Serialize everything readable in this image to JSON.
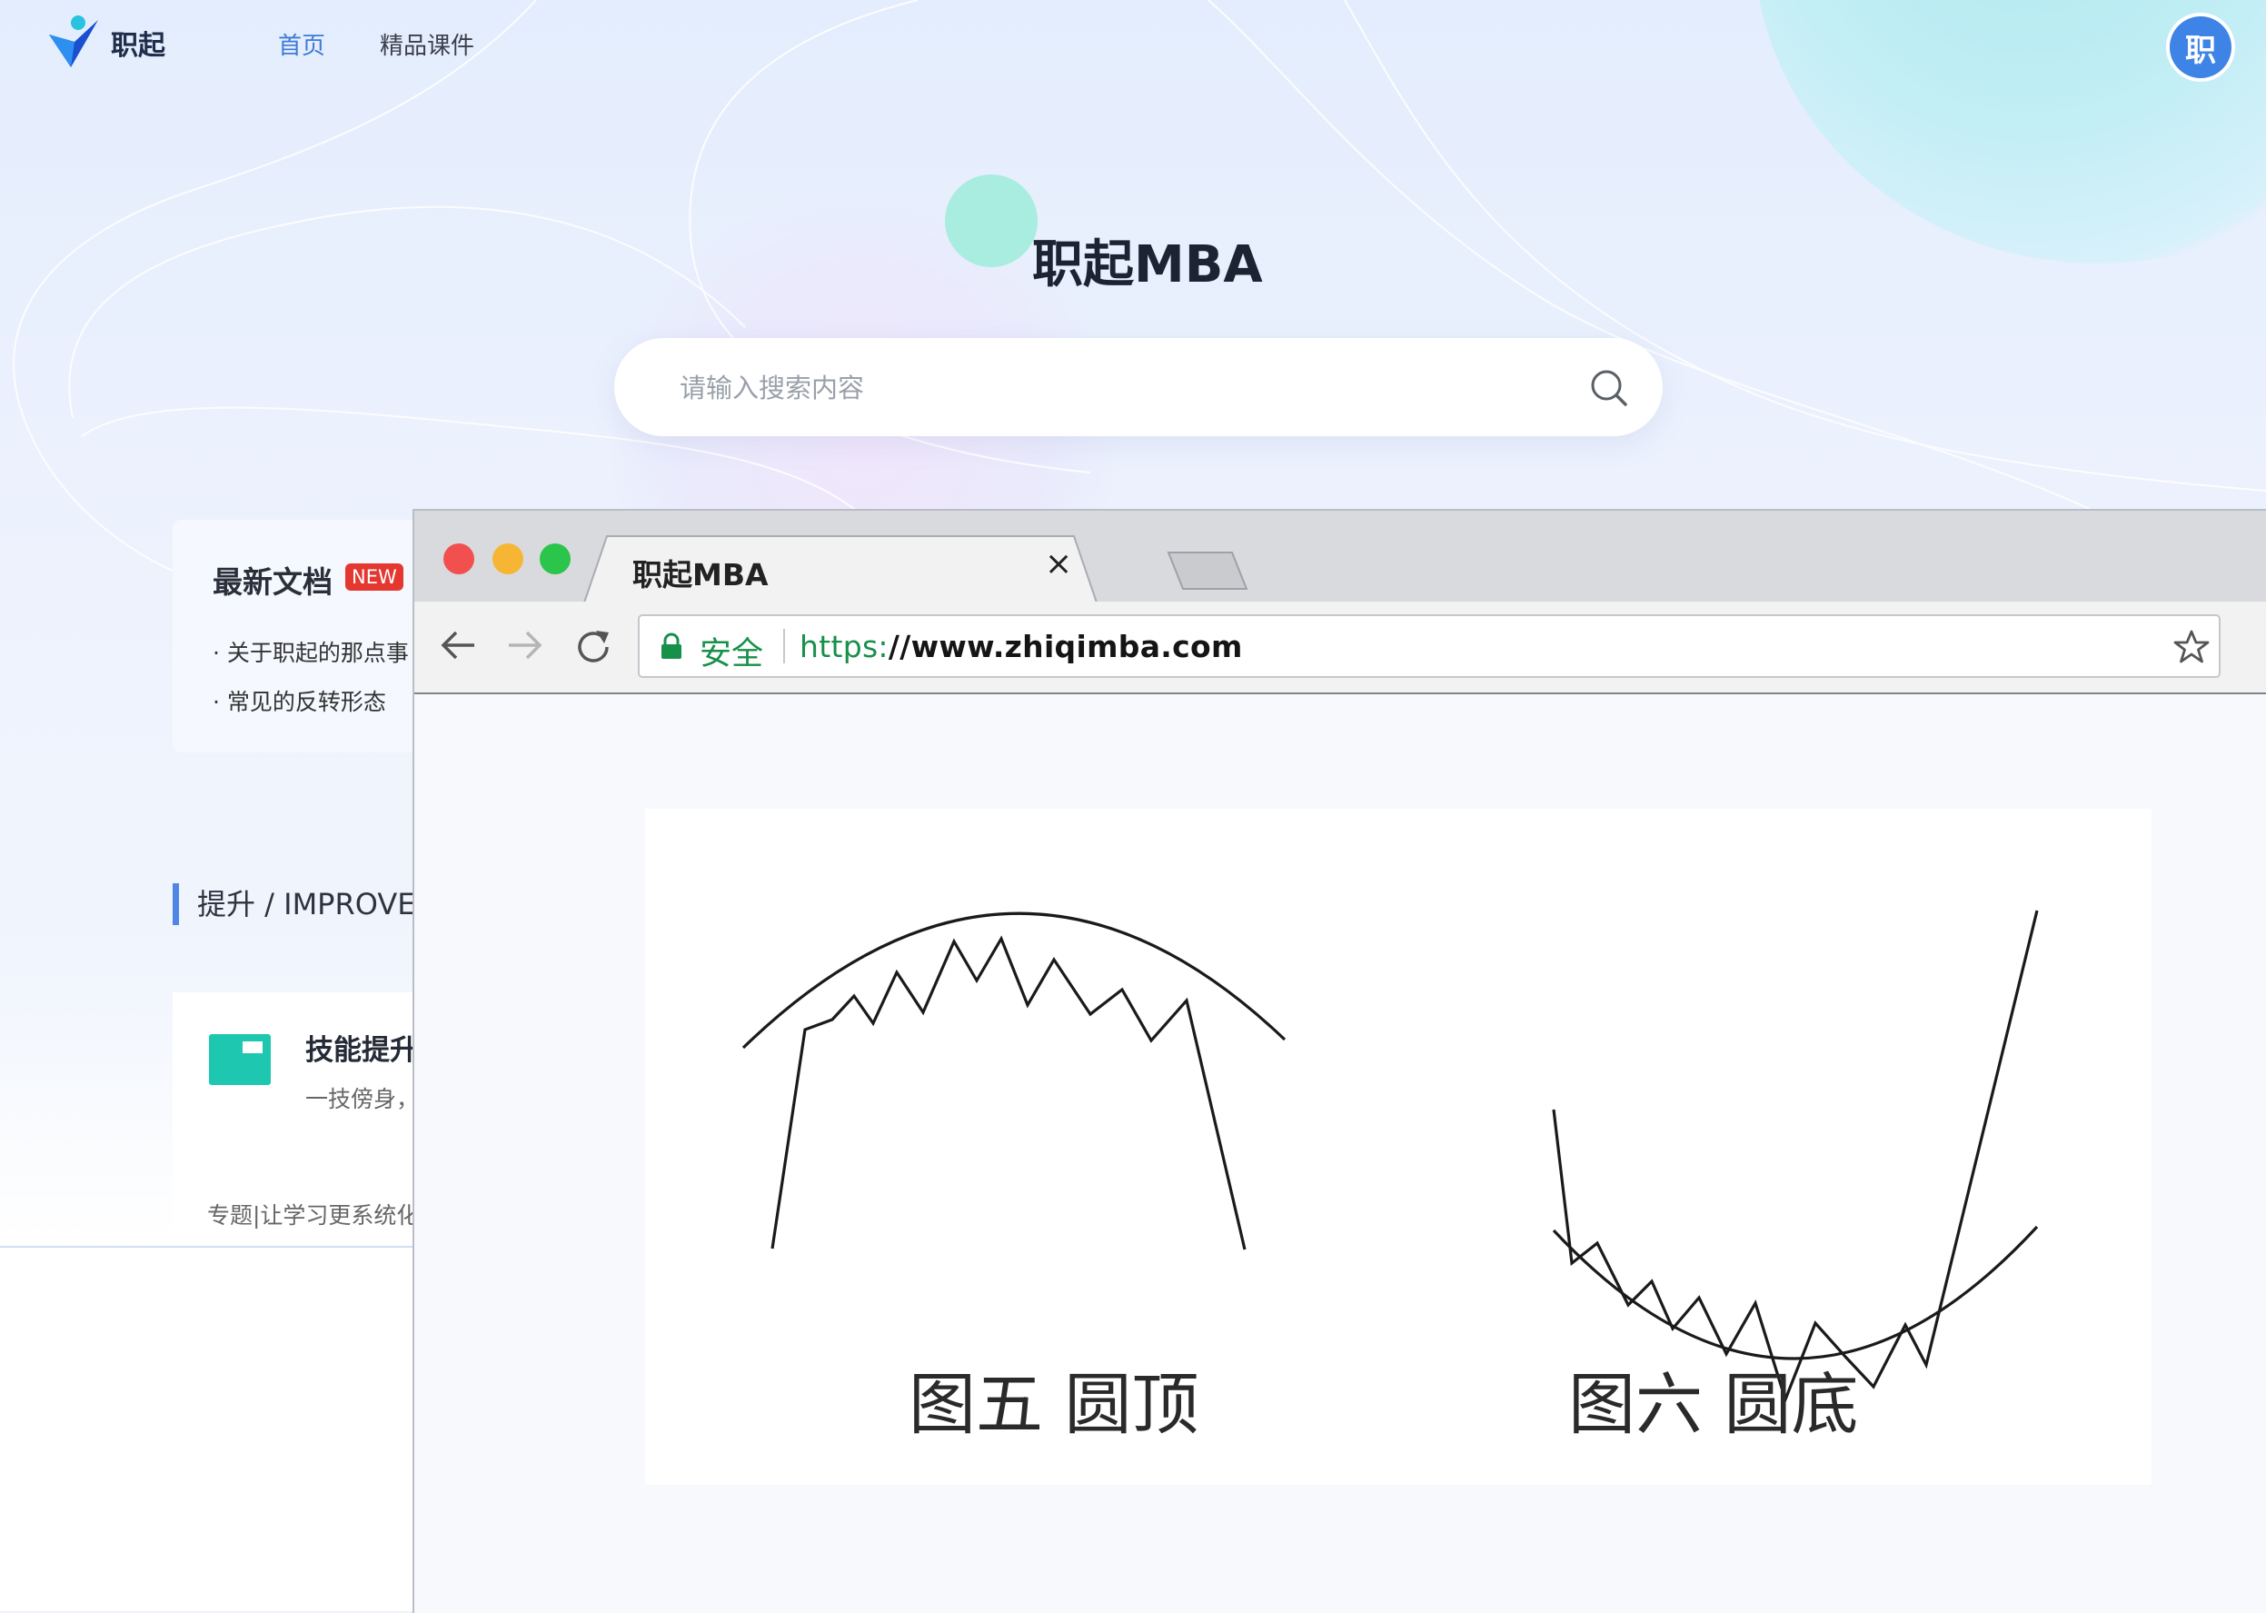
{
  "site": {
    "logo_text": "职起",
    "nav": [
      {
        "label": "首页"
      },
      {
        "label": "精品课件"
      }
    ],
    "avatar_text": "职",
    "hero_title": "职起MBA",
    "search": {
      "placeholder": "请输入搜索内容"
    },
    "news": {
      "title": "最新文档",
      "badge": "NEW",
      "items": [
        "关于职起的那点事",
        "常见的反转形态"
      ]
    },
    "section_heading": "提升 / IMPROVE",
    "skill_card": {
      "title": "技能提升",
      "desc": "一技傍身，",
      "footer": "专题|让学习更系统化"
    }
  },
  "browser": {
    "tab_title": "职起MBA",
    "tab_close": "×",
    "secure_label": "安全",
    "url_protocol": "https:",
    "url_rest": "//www.zhiqimba.com",
    "figure": {
      "captions": [
        "图五  圆顶",
        "图六  圆底"
      ]
    }
  }
}
